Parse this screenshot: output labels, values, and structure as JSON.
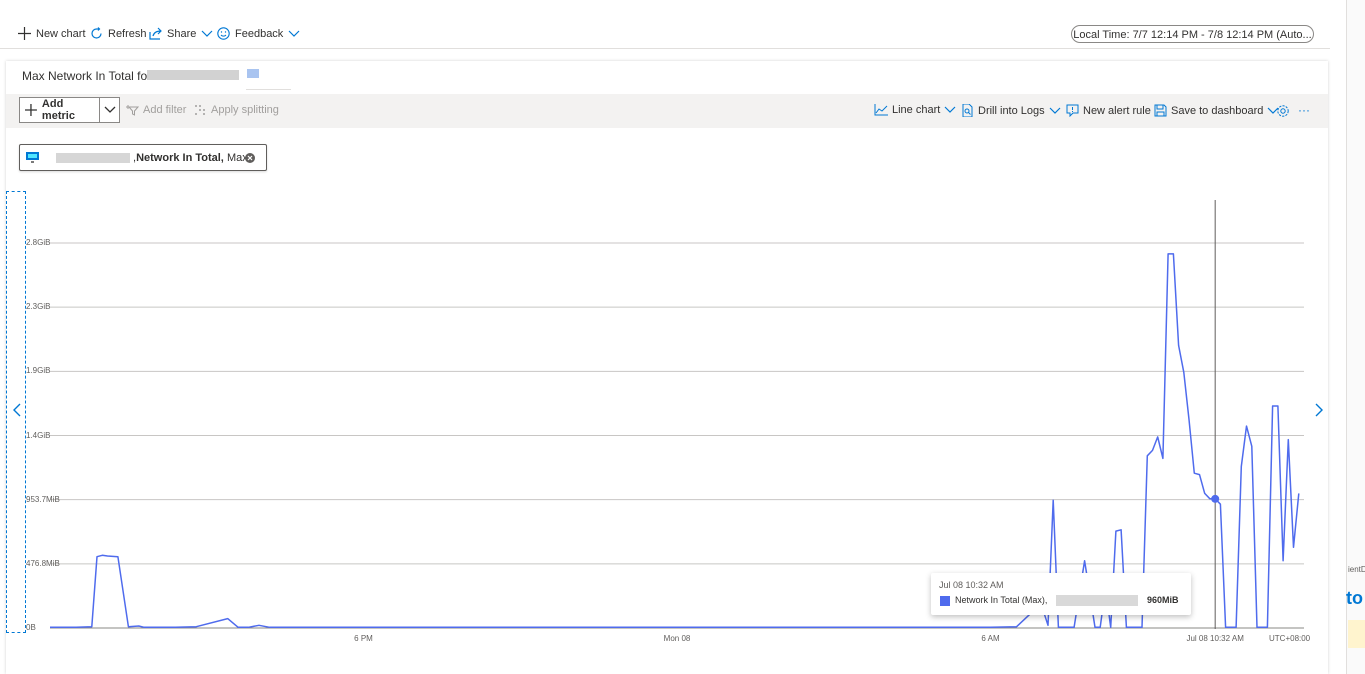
{
  "commands": {
    "new_chart": "New chart",
    "refresh": "Refresh",
    "share": "Share",
    "feedback": "Feedback"
  },
  "time_range": "Local Time: 7/7 12:14 PM - 7/8 12:14 PM (Auto...",
  "chart": {
    "title": "Max Network In Total fo",
    "toolbar": {
      "add_metric": "Add metric",
      "add_filter": "Add filter",
      "apply_splitting": "Apply splitting",
      "line_chart": "Line chart",
      "drill_logs": "Drill into Logs",
      "new_alert": "New alert rule",
      "save_dashboard": "Save to dashboard",
      "more": "···"
    },
    "metric_pill": {
      "prefix": ",",
      "metric": "Network In Total,",
      "aggregation": "Max"
    },
    "tooltip": {
      "datetime": "Jul 08 10:32 AM",
      "series": "Network In Total (Max),",
      "value": "960MiB"
    },
    "timezone": "UTC+08:00"
  },
  "right_panel": {
    "text": "ientD",
    "blue": "to"
  },
  "colors": {
    "series": "#4f6bed",
    "accent": "#0078d4",
    "gridline": "#c8c6c4"
  },
  "chart_data": {
    "type": "line",
    "title": "Max Network In Total fo",
    "y_tick_labels": [
      "0B",
      "476.8MiB",
      "953.7MiB",
      "1.4GiB",
      "1.9GiB",
      "2.3GiB",
      "2.8GiB"
    ],
    "y_tick_values_mib": [
      0,
      476.8,
      953.7,
      1430.5,
      1907.3,
      2384.2,
      2861
    ],
    "x_tick_labels": [
      "6 PM",
      "Mon 08",
      "6 AM",
      "Jul 08 10:32 AM"
    ],
    "x_tick_hours": [
      6,
      12,
      18,
      22.3
    ],
    "x_range_hours": [
      0,
      24
    ],
    "ylim_mib": [
      0,
      3100
    ],
    "grid": true,
    "cursor_hour": 22.3,
    "series": [
      {
        "name": "Network In Total (Max)",
        "x_hours": [
          0,
          0.2,
          0.5,
          0.8,
          0.9,
          1.0,
          1.1,
          1.3,
          1.5,
          1.7,
          1.8,
          1.9,
          2.0,
          2.4,
          2.8,
          3.4,
          3.6,
          3.7,
          3.8,
          4.0,
          4.2,
          4.5,
          5,
          6,
          8,
          10,
          12,
          14,
          16,
          17,
          18,
          18.5,
          18.8,
          19.0,
          19.1,
          19.2,
          19.3,
          19.4,
          19.5,
          19.6,
          19.8,
          20.0,
          20.1,
          20.2,
          20.3,
          20.4,
          20.5,
          20.6,
          20.7,
          20.9,
          21.0,
          21.1,
          21.2,
          21.3,
          21.4,
          21.5,
          21.6,
          21.7,
          21.8,
          21.9,
          22.0,
          22.1,
          22.2,
          22.3,
          22.4,
          22.5,
          22.6,
          22.7,
          22.8,
          22.9,
          23.0,
          23.1,
          23.2,
          23.3,
          23.4,
          23.5,
          23.6,
          23.7,
          23.8,
          23.9
        ],
        "values_mib": [
          5,
          5,
          5,
          10,
          530,
          540,
          535,
          530,
          10,
          15,
          5,
          5,
          5,
          5,
          10,
          70,
          5,
          5,
          5,
          20,
          5,
          5,
          5,
          5,
          5,
          5,
          5,
          5,
          5,
          5,
          5,
          10,
          120,
          140,
          20,
          950,
          5,
          5,
          5,
          5,
          500,
          5,
          5,
          300,
          5,
          720,
          730,
          5,
          5,
          5,
          1280,
          1320,
          1420,
          1260,
          2780,
          2780,
          2100,
          1900,
          1550,
          1150,
          1140,
          1000,
          960,
          960,
          920,
          5,
          5,
          5,
          1200,
          1500,
          1350,
          5,
          5,
          5,
          1650,
          1650,
          500,
          1400,
          600,
          1000
        ],
        "values_mib_note": ""
      }
    ]
  }
}
